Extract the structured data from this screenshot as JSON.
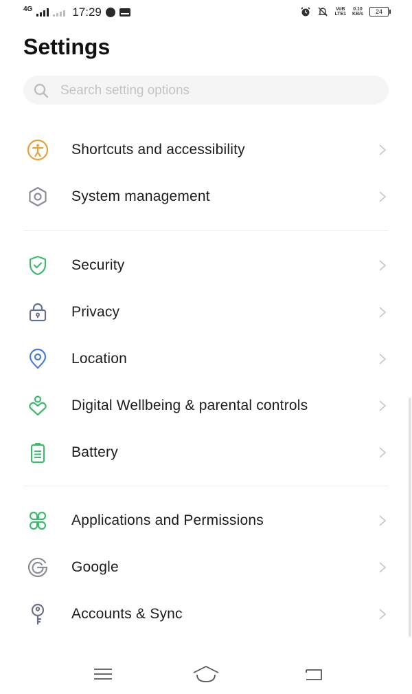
{
  "status_bar": {
    "network": "4G",
    "time": "17:29",
    "volte_line1": "VoB",
    "volte_line2": "LTE1",
    "speed_line1": "0.10",
    "speed_line2": "KB/s",
    "battery": "24"
  },
  "header": {
    "title": "Settings"
  },
  "search": {
    "placeholder": "Search setting options",
    "value": ""
  },
  "colors": {
    "accent_orange": "#E8A03A",
    "gray_icon": "#8A8E94",
    "green": "#3DBA6E",
    "blue": "#4C7BD9",
    "purple_gray": "#6A6F8C"
  },
  "settings": {
    "items": [
      {
        "label": "Shortcuts and accessibility",
        "icon": "accessibility-icon"
      },
      {
        "label": "System management",
        "icon": "system-hexagon-icon"
      },
      {
        "label": "Security",
        "icon": "shield-check-icon"
      },
      {
        "label": "Privacy",
        "icon": "lock-icon"
      },
      {
        "label": "Location",
        "icon": "location-pin-icon"
      },
      {
        "label": "Digital Wellbeing & parental controls",
        "icon": "wellbeing-heart-icon"
      },
      {
        "label": "Battery",
        "icon": "battery-icon"
      },
      {
        "label": "Applications and Permissions",
        "icon": "apps-grid-icon"
      },
      {
        "label": "Google",
        "icon": "google-icon"
      },
      {
        "label": "Accounts & Sync",
        "icon": "key-icon"
      }
    ]
  },
  "nav": {
    "buttons": [
      "menu-icon",
      "home-icon",
      "back-icon"
    ]
  }
}
